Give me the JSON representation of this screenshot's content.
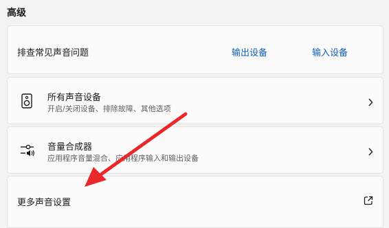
{
  "section": {
    "title": "高级"
  },
  "troubleshoot": {
    "label": "排查常见声音问题",
    "output_link": "输出设备",
    "input_link": "输入设备"
  },
  "all_devices": {
    "title": "所有声音设备",
    "subtitle": "开启/关闭设备、排除故障、其他选项",
    "icon": "speaker-icon"
  },
  "volume_mixer": {
    "title": "音量合成器",
    "subtitle": "应用程序音量混合、应用程序输入和输出设备",
    "icon": "mixer-icon"
  },
  "more_settings": {
    "label": "更多声音设置",
    "icon": "external-link-icon"
  },
  "colors": {
    "link": "#0f5fb5",
    "annotation_arrow": "#e8282a",
    "card_bg": "#fbfbfb",
    "page_bg": "#f3f3f3"
  }
}
